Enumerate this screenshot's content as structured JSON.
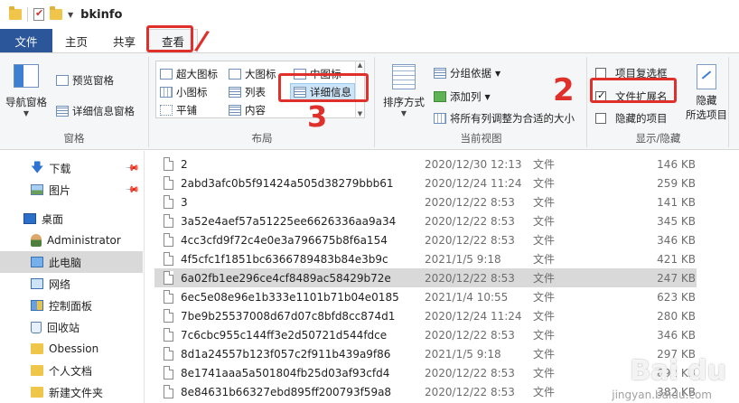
{
  "window": {
    "title": "bkinfo"
  },
  "tabs": [
    {
      "label": "文件"
    },
    {
      "label": "主页"
    },
    {
      "label": "共享"
    },
    {
      "label": "查看"
    }
  ],
  "ribbon": {
    "panes": {
      "nav_pane": "导航窗格",
      "preview_pane": "预览窗格",
      "details_pane": "详细信息窗格",
      "group_label": "窗格"
    },
    "layout": {
      "items": [
        "超大图标",
        "大图标",
        "中图标",
        "小图标",
        "列表",
        "详细信息",
        "平铺",
        "内容"
      ],
      "group_label": "布局"
    },
    "current_view": {
      "sort_by": "排序方式",
      "group_by": "分组依据",
      "add_columns": "添加列",
      "fit_columns": "将所有列调整为合适的大小",
      "group_label": "当前视图"
    },
    "show_hide": {
      "item_checkboxes": "项目复选框",
      "file_extensions": "文件扩展名",
      "hidden_items": "隐藏的项目",
      "hide_selected_line1": "隐藏",
      "hide_selected_line2": "所选项目",
      "group_label": "显示/隐藏",
      "item_checkboxes_checked": false,
      "file_extensions_checked": true,
      "hidden_items_checked": false
    }
  },
  "nav": {
    "items": [
      {
        "label": "下载",
        "icon": "download-icon"
      },
      {
        "label": "图片",
        "icon": "pictures-icon"
      },
      {
        "label": "桌面",
        "icon": "desktop-icon"
      },
      {
        "label": "Administrator",
        "icon": "user-icon"
      },
      {
        "label": "此电脑",
        "icon": "computer-icon"
      },
      {
        "label": "网络",
        "icon": "network-icon"
      },
      {
        "label": "控制面板",
        "icon": "control-panel-icon"
      },
      {
        "label": "回收站",
        "icon": "recycle-bin-icon"
      },
      {
        "label": "Obession",
        "icon": "folder-icon"
      },
      {
        "label": "个人文档",
        "icon": "folder-icon"
      },
      {
        "label": "新建文件夹",
        "icon": "folder-icon"
      }
    ]
  },
  "files": [
    {
      "name": "2",
      "date": "2020/12/30 12:13",
      "type": "文件",
      "size": "146 KB"
    },
    {
      "name": "2abd3afc0b5f91424a505d38279bbb61",
      "date": "2020/12/24 11:24",
      "type": "文件",
      "size": "259 KB"
    },
    {
      "name": "3",
      "date": "2020/12/22 8:53",
      "type": "文件",
      "size": "141 KB"
    },
    {
      "name": "3a52e4aef57a51225ee6626336aa9a34",
      "date": "2020/12/22 8:53",
      "type": "文件",
      "size": "345 KB"
    },
    {
      "name": "4cc3cfd9f72c4e0e3a796675b8f6a154",
      "date": "2020/12/22 8:53",
      "type": "文件",
      "size": "346 KB"
    },
    {
      "name": "4f5cfc1f1851bc6366789483b84e3b9c",
      "date": "2021/1/5 9:18",
      "type": "文件",
      "size": "421 KB"
    },
    {
      "name": "6a02fb1ee296ce4cf8489ac58429b72e",
      "date": "2020/12/22 8:53",
      "type": "文件",
      "size": "247 KB"
    },
    {
      "name": "6ec5e08e96e1b333e1101b71b04e0185",
      "date": "2021/1/4 10:55",
      "type": "文件",
      "size": "623 KB"
    },
    {
      "name": "7be9b25537008d67d07c8bfd8cc874d1",
      "date": "2020/12/24 11:24",
      "type": "文件",
      "size": "280 KB"
    },
    {
      "name": "7c6cbc955c144ff3e2d50721d544fdce",
      "date": "2020/12/22 8:53",
      "type": "文件",
      "size": "346 KB"
    },
    {
      "name": "8d1a24557b123f057c2f911b439a9f86",
      "date": "2021/1/5 9:18",
      "type": "文件",
      "size": "297 KB"
    },
    {
      "name": "8e1741aaa5a501804fb25d03af93cfd4",
      "date": "2020/12/22 8:53",
      "type": "文件",
      "size": "692 KB"
    },
    {
      "name": "8e84631b66327ebd895ff200793f59a8",
      "date": "2020/12/22 8:53",
      "type": "文件",
      "size": "382 KB"
    }
  ],
  "annotations": {
    "mark1": "/",
    "mark2": "2",
    "mark3": "3"
  },
  "watermark": {
    "brand": "Bai du",
    "sub": "jingyan.baidu.com"
  }
}
